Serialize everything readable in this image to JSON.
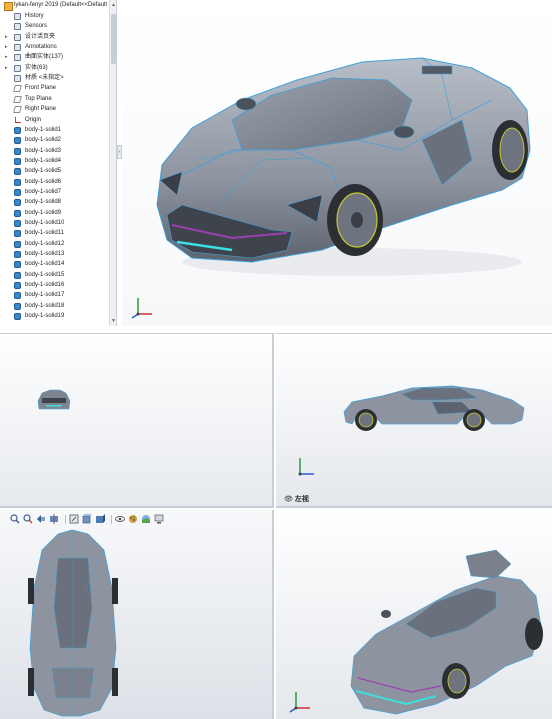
{
  "tree": {
    "title": "lykan-fenyr 2019  (Default<<Default",
    "items": [
      {
        "label": "History",
        "icon": "history-icon",
        "expand": ""
      },
      {
        "label": "Sensors",
        "icon": "sensor-icon",
        "expand": ""
      },
      {
        "label": "设计活页夹",
        "icon": "binder-icon",
        "expand": "▸"
      },
      {
        "label": "Annotations",
        "icon": "annotation-icon",
        "expand": "▸"
      },
      {
        "label": "曲面实体(137)",
        "icon": "surface-bodies-icon",
        "expand": "▸"
      },
      {
        "label": "实体(63)",
        "icon": "solid-bodies-icon",
        "expand": "▸"
      },
      {
        "label": "材质 <未指定>",
        "icon": "material-icon",
        "expand": ""
      },
      {
        "label": "Front Plane",
        "icon": "plane-icon",
        "expand": ""
      },
      {
        "label": "Top Plane",
        "icon": "plane-icon",
        "expand": ""
      },
      {
        "label": "Right Plane",
        "icon": "plane-icon",
        "expand": ""
      },
      {
        "label": "Origin",
        "icon": "origin-icon",
        "expand": ""
      },
      {
        "label": "body-1-solid1",
        "icon": "body-icon",
        "expand": ""
      },
      {
        "label": "body-1-solid2",
        "icon": "body-icon",
        "expand": ""
      },
      {
        "label": "body-1-solid3",
        "icon": "body-icon",
        "expand": ""
      },
      {
        "label": "body-1-solid4",
        "icon": "body-icon",
        "expand": ""
      },
      {
        "label": "body-1-solid5",
        "icon": "body-icon",
        "expand": ""
      },
      {
        "label": "body-1-solid6",
        "icon": "body-icon",
        "expand": ""
      },
      {
        "label": "body-1-solid7",
        "icon": "body-icon",
        "expand": ""
      },
      {
        "label": "body-1-solid8",
        "icon": "body-icon",
        "expand": ""
      },
      {
        "label": "body-1-solid9",
        "icon": "body-icon",
        "expand": ""
      },
      {
        "label": "body-1-solid10",
        "icon": "body-icon",
        "expand": ""
      },
      {
        "label": "body-1-solid11",
        "icon": "body-icon",
        "expand": ""
      },
      {
        "label": "body-1-solid12",
        "icon": "body-icon",
        "expand": ""
      },
      {
        "label": "body-1-solid13",
        "icon": "body-icon",
        "expand": ""
      },
      {
        "label": "body-1-solid14",
        "icon": "body-icon",
        "expand": ""
      },
      {
        "label": "body-1-solid15",
        "icon": "body-icon",
        "expand": ""
      },
      {
        "label": "body-1-solid16",
        "icon": "body-icon",
        "expand": ""
      },
      {
        "label": "body-1-solid17",
        "icon": "body-icon",
        "expand": ""
      },
      {
        "label": "body-1-solid18",
        "icon": "body-icon",
        "expand": ""
      },
      {
        "label": "body-1-solid19",
        "icon": "body-icon",
        "expand": ""
      }
    ]
  },
  "viewports": {
    "left_view_label": "左视"
  },
  "heads_up_toolbar": {
    "icons": [
      "zoom-to-fit-icon",
      "zoom-area-icon",
      "previous-view-icon",
      "section-view-icon",
      "dynamic-annotation-icon",
      "view-orientation-icon",
      "display-style-icon",
      "hide-show-items-icon",
      "edit-appearance-icon",
      "apply-scene-icon",
      "view-settings-icon"
    ]
  },
  "colors": {
    "car_body": "#8c939e",
    "car_edge": "#3fa0d8",
    "accent_light": "#3de0e0",
    "accent_purple": "#9b3fb0",
    "tree_body_icon": "#3a87c9"
  }
}
